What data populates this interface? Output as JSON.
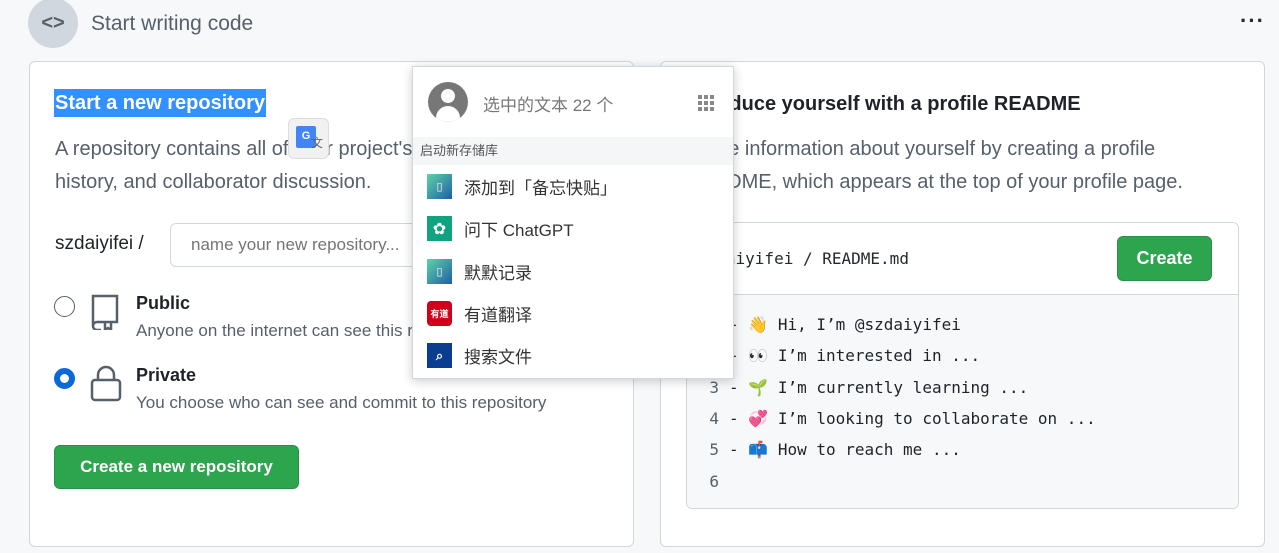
{
  "header": {
    "title": "Start writing code",
    "icon": "code-icon",
    "more_icon": "kebab-icon"
  },
  "left": {
    "title": "Start a new repository",
    "description_line1": "A repository contains all of your project's files, revision",
    "description_line2": "history, and collaborator discussion.",
    "owner": "szdaiyifei /",
    "name_placeholder": "name your new repository...",
    "options": [
      {
        "label": "Public",
        "desc": "Anyone on the internet can see this repository",
        "selected": false,
        "icon": "repo-icon"
      },
      {
        "label": "Private",
        "desc": "You choose who can see and commit to this repository",
        "selected": true,
        "icon": "lock-icon"
      }
    ],
    "create_button": "Create a new repository"
  },
  "right": {
    "title": "Introduce yourself with a profile README",
    "description_line1": "Share information about yourself by creating a profile",
    "description_line2": "README, which appears at the top of your profile page.",
    "path_owner": "szdaiyifei",
    "path_sep": "/",
    "path_file": "README.md",
    "create_button": "Create",
    "lines": [
      {
        "n": "1",
        "text": "- 👋 Hi, I’m @szdaiyifei"
      },
      {
        "n": "2",
        "text": "- 👀 I’m interested in ..."
      },
      {
        "n": "3",
        "text": "- 🌱 I’m currently learning ..."
      },
      {
        "n": "4",
        "text": "- 💞️ I’m looking to collaborate on ..."
      },
      {
        "n": "5",
        "text": "- 📫 How to reach me ..."
      },
      {
        "n": "6",
        "text": ""
      }
    ]
  },
  "popup": {
    "title": "选中的文本 22 个",
    "section": "启动新存储库",
    "items": [
      {
        "label": "添加到「备忘快贴」",
        "icon": "clipboard-icon",
        "color": "#2a9d8f"
      },
      {
        "label": "问下 ChatGPT",
        "icon": "chatgpt-icon",
        "color": "#10a37f"
      },
      {
        "label": "默默记录",
        "icon": "clipboard-icon",
        "color": "#2a9d8f"
      },
      {
        "label": "有道翻译",
        "icon": "youdao-icon",
        "color": "#d0021b",
        "icon_text": "有道"
      },
      {
        "label": "搜索文件",
        "icon": "search-icon",
        "color": "#0a3d8f"
      }
    ]
  },
  "translate_icon": {
    "letter": "G",
    "glyph": "文"
  }
}
